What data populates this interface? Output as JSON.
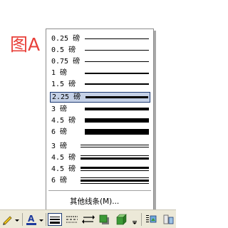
{
  "figure_label": "图A",
  "line_weight_menu": {
    "items": [
      {
        "label": "0.25 磅",
        "weight": 0.25,
        "style": "single"
      },
      {
        "label": "0.5 磅",
        "weight": 0.5,
        "style": "single"
      },
      {
        "label": "0.75 磅",
        "weight": 0.75,
        "style": "single"
      },
      {
        "label": "1 磅",
        "weight": 1,
        "style": "single"
      },
      {
        "label": "1.5 磅",
        "weight": 1.5,
        "style": "single"
      },
      {
        "label": "2.25 磅",
        "weight": 2.25,
        "style": "single",
        "selected": true
      },
      {
        "label": "3 磅",
        "weight": 3,
        "style": "single"
      },
      {
        "label": "4.5 磅",
        "weight": 4.5,
        "style": "single"
      },
      {
        "label": "6 磅",
        "weight": 6,
        "style": "single"
      },
      {
        "label": "3 磅",
        "weight": 3,
        "style": "double"
      },
      {
        "label": "4.5 磅",
        "weight": 4.5,
        "style": "thin-thick"
      },
      {
        "label": "4.5 磅",
        "weight": 4.5,
        "style": "thick-thin"
      },
      {
        "label": "6 磅",
        "weight": 6,
        "style": "thick-between-thin"
      }
    ],
    "more_lines_label": "其他线条(M)..."
  },
  "toolbar": {
    "buttons": [
      {
        "name": "line-color-button",
        "icon": "pencil-icon"
      },
      {
        "name": "font-color-button",
        "icon": "font-color-a-icon"
      },
      {
        "name": "line-style-button",
        "icon": "line-style-icon",
        "active": true
      },
      {
        "name": "dash-style-button",
        "icon": "dash-style-icon"
      },
      {
        "name": "arrow-style-button",
        "icon": "arrow-style-icon"
      },
      {
        "name": "shadow-style-button",
        "icon": "shadow-icon"
      },
      {
        "name": "3d-style-button",
        "icon": "3d-icon"
      },
      {
        "name": "toolbar-options-button",
        "icon": "chevron-down-icon"
      },
      {
        "name": "text-wrap-button",
        "icon": "text-wrap-icon"
      },
      {
        "name": "more-tools-button",
        "icon": "more-tools-icon"
      }
    ],
    "colors": {
      "font_color_underline": "#1e3a9c",
      "pencil_yellow": "#f2c418",
      "shadow_green": "#3c9a36"
    }
  }
}
